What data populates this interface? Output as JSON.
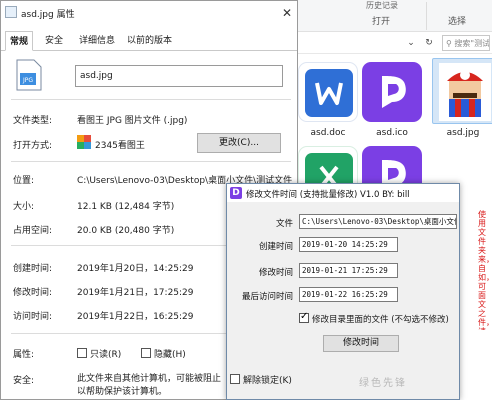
{
  "explorer": {
    "ribbon_top_label": "历史记录",
    "ribbon_group_open": "打开",
    "ribbon_group_select": "选择",
    "search_placeholder": "搜索\"测试...",
    "tiles": [
      {
        "name": "asd.doc",
        "color": "#2f6fd6"
      },
      {
        "name": "asd.ico",
        "color": "#7b3fe4"
      },
      {
        "name": "asd.jpg",
        "color": "#c83a2e"
      }
    ],
    "lower_tile_colors": [
      "#21a366",
      "#7b3fe4"
    ]
  },
  "properties": {
    "title": "asd.jpg 属性",
    "tabs": [
      "常规",
      "安全",
      "详细信息",
      "以前的版本"
    ],
    "filename": "asd.jpg",
    "file_type_label": "文件类型:",
    "file_type_value": "看图王 JPG 图片文件 (.jpg)",
    "open_with_label": "打开方式:",
    "open_with_value": "2345看图王",
    "change_button": "更改(C)...",
    "location_label": "位置:",
    "location_value": "C:\\Users\\Lenovo-03\\Desktop\\桌面小文件\\测试文件",
    "size_label": "大小:",
    "size_value": "12.1 KB (12,484 字节)",
    "size_on_disk_label": "占用空间:",
    "size_on_disk_value": "20.0 KB (20,480 字节)",
    "created_label": "创建时间:",
    "created_value": "2019年1月20日，14:25:29",
    "modified_label": "修改时间:",
    "modified_value": "2019年1月21日，17:25:29",
    "accessed_label": "访问时间:",
    "accessed_value": "2019年1月22日，16:25:29",
    "attributes_label": "属性:",
    "readonly_label": "只读(R)",
    "hidden_label": "隐藏(H)",
    "security_label": "安全:",
    "security_text_1": "此文件来自其他计算机，可能被阻止",
    "security_text_2": "以帮助保护该计算机。",
    "unblock_label": "解除锁定(K)"
  },
  "tool": {
    "title": "修改文件时间 (支持批量修改)  V1.0  BY: bill",
    "file_label": "文件",
    "file_value": "C:\\Users\\Lenovo-03\\Desktop\\桌面小文件",
    "created_label": "创建时间",
    "created_value": "2019-01-20 14:25:29",
    "modified_label": "修改时间",
    "modified_value": "2019-01-21 17:25:29",
    "accessed_label": "最后访问时间",
    "accessed_value": "2019-01-22 16:25:29",
    "subfolder_label": "修改目录里面的文件 (不勾选不修改)",
    "subfolder_checked": true,
    "submit_button": "修改时间",
    "side_note": "使用文件夹来，自如，可面文之件，请修改所使用",
    "watermark": "绿色先锋"
  }
}
